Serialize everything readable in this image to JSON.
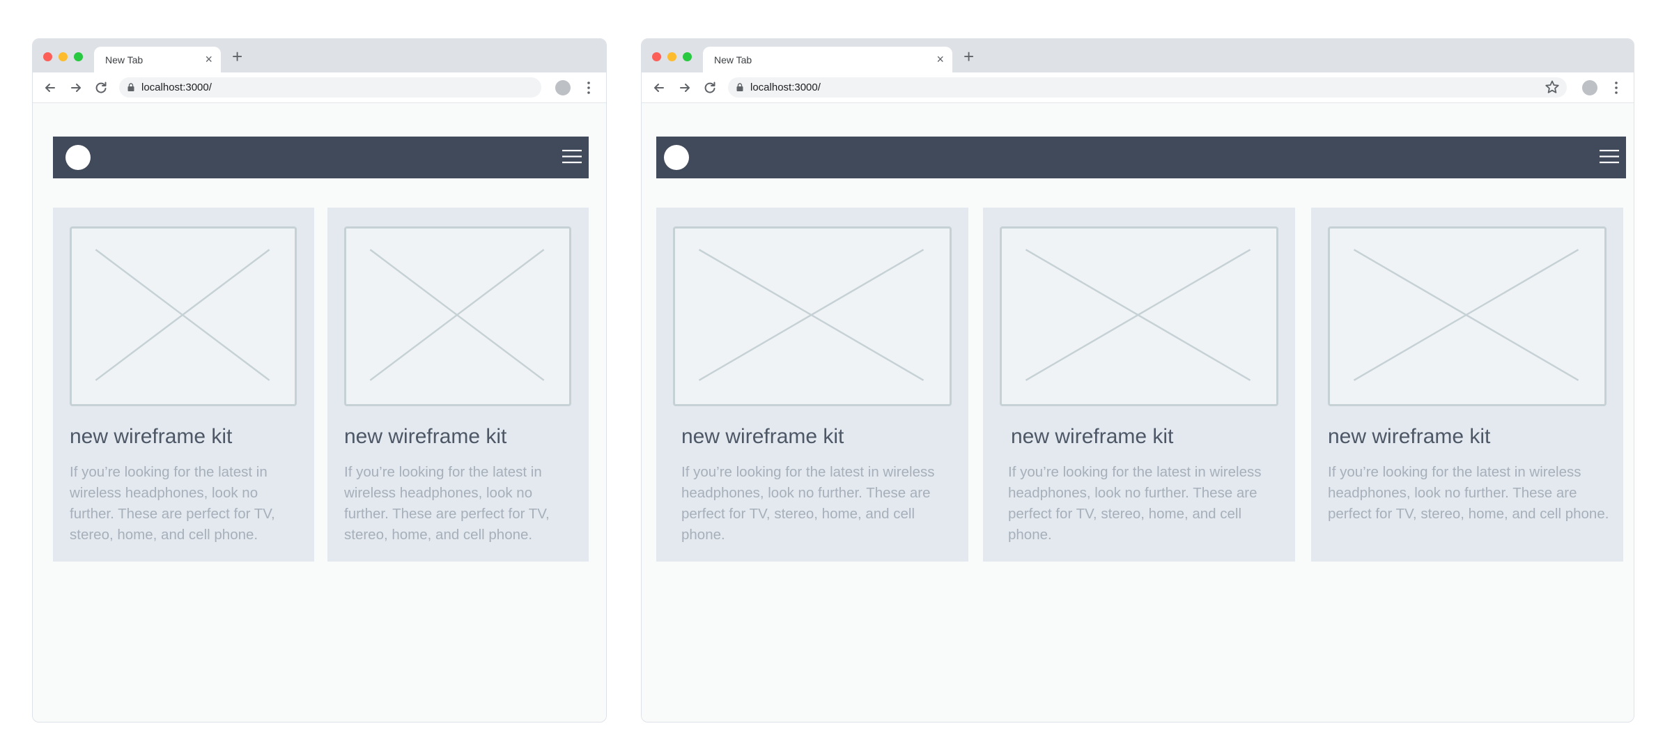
{
  "browsers": [
    {
      "tab": {
        "title": "New Tab",
        "close": "×"
      },
      "new_tab_glyph": "+",
      "address": {
        "url": "localhost:3000/"
      },
      "cards": [
        {
          "title": "new wireframe kit",
          "description": "If you’re looking for the latest in wireless headphones, look no further. These are perfect for TV, stereo, home, and cell phone."
        },
        {
          "title": "new wireframe kit",
          "description": "If you’re looking for the latest in wireless headphones, look no further. These are perfect for TV, stereo, home, and cell phone."
        }
      ]
    },
    {
      "tab": {
        "title": "New Tab",
        "close": "×"
      },
      "new_tab_glyph": "+",
      "address": {
        "url": "localhost:3000/"
      },
      "cards": [
        {
          "title": "new wireframe kit",
          "description": "If you’re looking for the latest in wireless headphones, look no further. These are perfect for TV, stereo, home, and cell phone."
        },
        {
          "title": "new wireframe kit",
          "description": "If you’re looking for the latest in wireless headphones, look no further. These are perfect for TV, stereo, home, and cell phone."
        },
        {
          "title": "new wireframe kit",
          "description": "If you’re looking for the latest in wireless headphones, look no further. These are perfect for TV, stereo, home, and cell phone."
        }
      ]
    }
  ],
  "colors": {
    "header_bg": "#404a5a",
    "card_bg": "#e3e9ef",
    "placeholder_border": "#c6d1d6",
    "title_text": "#4d5766",
    "body_text": "#a7b0ba"
  },
  "icons": {
    "back": "arrow-left-icon",
    "forward": "arrow-right-icon",
    "reload": "reload-icon",
    "lock": "lock-icon",
    "bookmark": "star-icon",
    "profile": "profile-avatar-icon",
    "menu": "vertical-dots-icon",
    "site_menu": "hamburger-icon",
    "logo": "circle-logo-icon",
    "placeholder": "image-placeholder-icon"
  }
}
